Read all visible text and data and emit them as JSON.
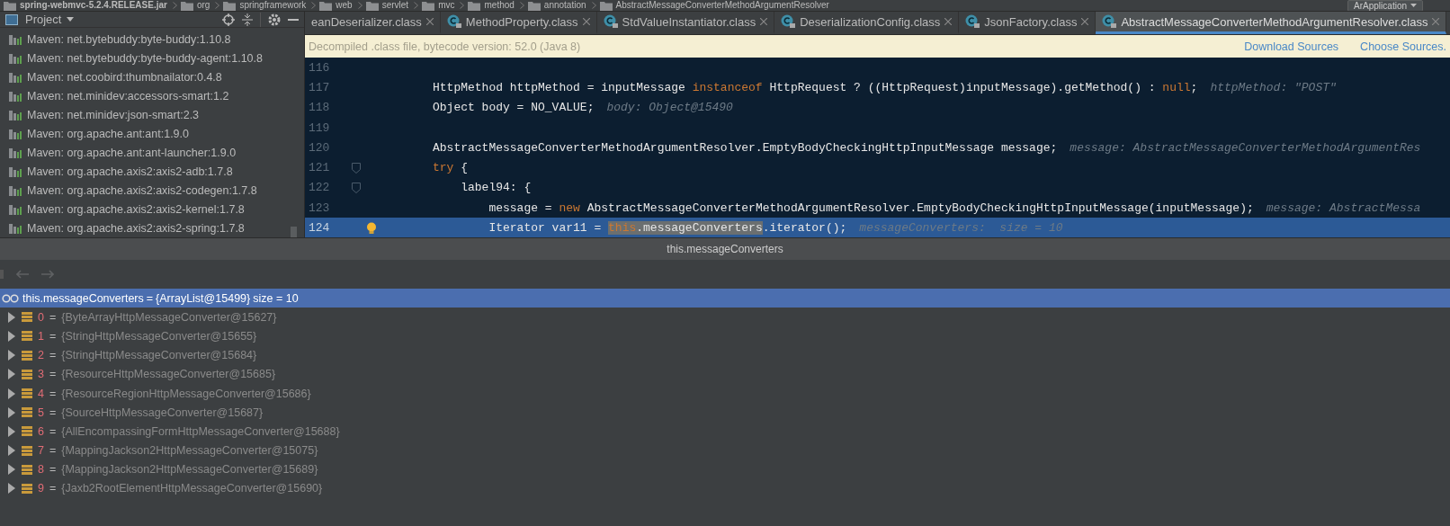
{
  "breadcrumb": {
    "items": [
      "spring-webmvc-5.2.4.RELEASE.jar",
      "org",
      "springframework",
      "web",
      "servlet",
      "mvc",
      "method",
      "annotation",
      "AbstractMessageConverterMethodArgumentResolver"
    ],
    "run_config": "ArApplication"
  },
  "project": {
    "title": "Project",
    "items": [
      "Maven: net.bytebuddy:byte-buddy:1.10.8",
      "Maven: net.bytebuddy:byte-buddy-agent:1.10.8",
      "Maven: net.coobird:thumbnailator:0.4.8",
      "Maven: net.minidev:accessors-smart:1.2",
      "Maven: net.minidev:json-smart:2.3",
      "Maven: org.apache.ant:ant:1.9.0",
      "Maven: org.apache.ant:ant-launcher:1.9.0",
      "Maven: org.apache.axis2:axis2-adb:1.7.8",
      "Maven: org.apache.axis2:axis2-codegen:1.7.8",
      "Maven: org.apache.axis2:axis2-kernel:1.7.8",
      "Maven: org.apache.axis2:axis2-spring:1.7.8"
    ]
  },
  "tabs": [
    {
      "label": "eanDeserializer.class",
      "selected": false,
      "kind": "cut"
    },
    {
      "label": "MethodProperty.class",
      "selected": false,
      "kind": "class"
    },
    {
      "label": "StdValueInstantiator.class",
      "selected": false,
      "kind": "class"
    },
    {
      "label": "DeserializationConfig.class",
      "selected": false,
      "kind": "class"
    },
    {
      "label": "JsonFactory.class",
      "selected": false,
      "kind": "class"
    },
    {
      "label": "AbstractMessageConverterMethodArgumentResolver.class",
      "selected": true,
      "kind": "class"
    }
  ],
  "info_bar": {
    "message": "Decompiled .class file, bytecode version: 52.0 (Java 8)",
    "links": [
      "Download Sources",
      "Choose Sources."
    ]
  },
  "code": [
    {
      "number": "116",
      "current": false,
      "foldable": false,
      "bulb": false
    },
    {
      "number": "117",
      "current": false,
      "foldable": false,
      "bulb": false,
      "tokens": [
        {
          "kind": "plain",
          "text": "HttpMethod httpMethod = inputMessage "
        },
        {
          "kind": "keyword",
          "text": "instanceof"
        },
        {
          "kind": "plain",
          "text": " HttpRequest ? ((HttpRequest)inputMessage).getMethod() : "
        },
        {
          "kind": "keyword",
          "text": "null"
        },
        {
          "kind": "plain",
          "text": ";"
        },
        {
          "kind": "hint",
          "text": "httpMethod: \"POST\""
        }
      ]
    },
    {
      "number": "118",
      "current": false,
      "foldable": false,
      "bulb": false,
      "tokens": [
        {
          "kind": "plain",
          "text": "Object body = NO_VALUE;"
        },
        {
          "kind": "hint",
          "text": "body: Object@15490"
        }
      ]
    },
    {
      "number": "119",
      "current": false,
      "foldable": false,
      "bulb": false
    },
    {
      "number": "120",
      "current": false,
      "foldable": false,
      "bulb": false,
      "tokens": [
        {
          "kind": "plain",
          "text": "AbstractMessageConverterMethodArgumentResolver.EmptyBodyCheckingHttpInputMessage message;"
        },
        {
          "kind": "hint",
          "text": "message: AbstractMessageConverterMethodArgumentRes"
        }
      ]
    },
    {
      "number": "121",
      "current": false,
      "foldable": true,
      "bulb": false,
      "tokens": [
        {
          "kind": "keyword",
          "text": "try"
        },
        {
          "kind": "plain",
          "text": " {"
        }
      ]
    },
    {
      "number": "122",
      "current": false,
      "foldable": true,
      "bulb": false,
      "tokens": [
        {
          "kind": "plain",
          "text": "    label94: {"
        }
      ]
    },
    {
      "number": "123",
      "current": false,
      "foldable": false,
      "bulb": false,
      "tokens": [
        {
          "kind": "plain",
          "text": "        message = "
        },
        {
          "kind": "keyword",
          "text": "new"
        },
        {
          "kind": "plain",
          "text": " AbstractMessageConverterMethodArgumentResolver.EmptyBodyCheckingHttpInputMessage(inputMessage);"
        },
        {
          "kind": "hint",
          "text": "message: AbstractMessa"
        }
      ]
    },
    {
      "number": "124",
      "current": true,
      "foldable": false,
      "bulb": true,
      "tokens": [
        {
          "kind": "plain",
          "text": "        Iterator var11 = "
        },
        {
          "kind": "hl_keyword",
          "text": "this"
        },
        {
          "kind": "hl_plain",
          "text": ".messageConverters"
        },
        {
          "kind": "plain",
          "text": ".iterator();"
        },
        {
          "kind": "hint",
          "text": "messageConverters:  size = 10"
        }
      ]
    }
  ],
  "debugger": {
    "title": "this.messageConverters",
    "watch": {
      "expression": "this.messageConverters",
      "op": "=",
      "value": "{ArrayList@15499}",
      "extra": "size = 10",
      "selected": true
    },
    "children": [
      {
        "name": "0",
        "op": "=",
        "value": "{ByteArrayHttpMessageConverter@15627}",
        "expanded": false
      },
      {
        "name": "1",
        "op": "=",
        "value": "{StringHttpMessageConverter@15655}",
        "expanded": false
      },
      {
        "name": "2",
        "op": "=",
        "value": "{StringHttpMessageConverter@15684}",
        "expanded": false
      },
      {
        "name": "3",
        "op": "=",
        "value": "{ResourceHttpMessageConverter@15685}",
        "expanded": false
      },
      {
        "name": "4",
        "op": "=",
        "value": "{ResourceRegionHttpMessageConverter@15686}",
        "expanded": false
      },
      {
        "name": "5",
        "op": "=",
        "value": "{SourceHttpMessageConverter@15687}",
        "expanded": false
      },
      {
        "name": "6",
        "op": "=",
        "value": "{AllEncompassingFormHttpMessageConverter@15688}",
        "expanded": false
      },
      {
        "name": "7",
        "op": "=",
        "value": "{MappingJackson2HttpMessageConverter@15075}",
        "expanded": false
      },
      {
        "name": "8",
        "op": "=",
        "value": "{MappingJackson2HttpMessageConverter@15689}",
        "expanded": false
      },
      {
        "name": "9",
        "op": "=",
        "value": "{Jaxb2RootElementHttpMessageConverter@15690}",
        "expanded": false
      }
    ]
  }
}
